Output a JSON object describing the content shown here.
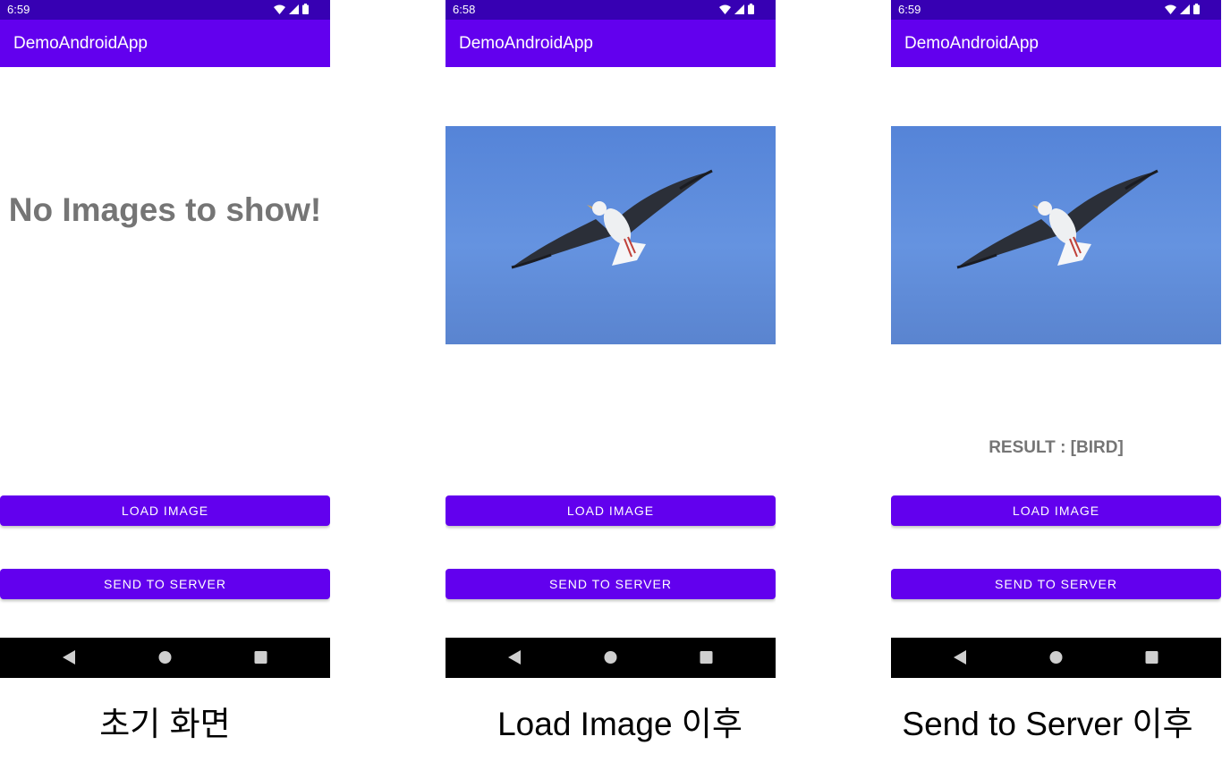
{
  "screens": [
    {
      "status_time": "6:59",
      "app_title": "DemoAndroidApp",
      "empty_message": "No Images to show!",
      "result": "",
      "load_button": "LOAD IMAGE",
      "send_button": "SEND TO SERVER",
      "caption": "초기 화면",
      "image_shown": false
    },
    {
      "status_time": "6:58",
      "app_title": "DemoAndroidApp",
      "empty_message": "",
      "result": "",
      "load_button": "LOAD IMAGE",
      "send_button": "SEND TO SERVER",
      "caption": "Load Image 이후",
      "image_shown": true
    },
    {
      "status_time": "6:59",
      "app_title": "DemoAndroidApp",
      "empty_message": "",
      "result": "RESULT : [BIRD]",
      "load_button": "LOAD IMAGE",
      "send_button": "SEND TO SERVER",
      "caption": "Send to Server 이후",
      "image_shown": true
    }
  ],
  "colors": {
    "status_bar": "#3700b3",
    "app_bar": "#6200ee",
    "button": "#6200ee",
    "nav_bar": "#000000",
    "muted_text": "#757575",
    "sky": "#6593e0"
  },
  "icons": [
    "wifi-icon",
    "cell-signal-icon",
    "battery-icon",
    "nav-back-icon",
    "nav-home-icon",
    "nav-recents-icon"
  ]
}
